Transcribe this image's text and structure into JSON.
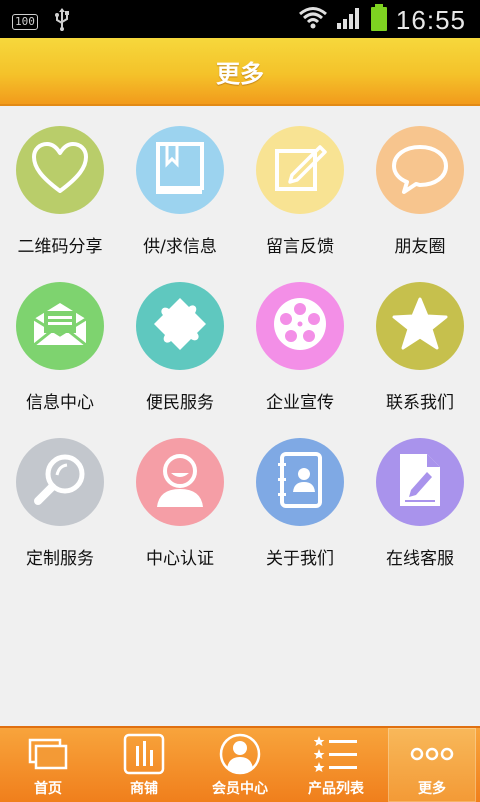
{
  "status_bar": {
    "battery_text": "100",
    "time": "16:55"
  },
  "header": {
    "title": "更多"
  },
  "grid": {
    "items": [
      {
        "label": "二维码分享",
        "icon": "heart-icon",
        "color": "#b9cd6a"
      },
      {
        "label": "供/求信息",
        "icon": "book-icon",
        "color": "#9cd3ef"
      },
      {
        "label": "留言反馈",
        "icon": "edit-icon",
        "color": "#f8e393"
      },
      {
        "label": "朋友圈",
        "icon": "chat-bubble-icon",
        "color": "#f7c58e"
      },
      {
        "label": "信息中心",
        "icon": "mail-icon",
        "color": "#7ed36f"
      },
      {
        "label": "便民服务",
        "icon": "puzzle-icon",
        "color": "#5fc8bf"
      },
      {
        "label": "企业宣传",
        "icon": "film-reel-icon",
        "color": "#f38fe7"
      },
      {
        "label": "联系我们",
        "icon": "star-icon",
        "color": "#c6c04d"
      },
      {
        "label": "定制服务",
        "icon": "magnifier-icon",
        "color": "#c3c7cd"
      },
      {
        "label": "中心认证",
        "icon": "user-icon",
        "color": "#f59ea6"
      },
      {
        "label": "关于我们",
        "icon": "contacts-icon",
        "color": "#7fa9e4"
      },
      {
        "label": "在线客服",
        "icon": "document-edit-icon",
        "color": "#a993ec"
      }
    ]
  },
  "tabbar": {
    "tabs": [
      {
        "label": "首页",
        "icon": "windows-icon",
        "active": false
      },
      {
        "label": "商铺",
        "icon": "shop-bars-icon",
        "active": false
      },
      {
        "label": "会员中心",
        "icon": "member-icon",
        "active": false
      },
      {
        "label": "产品列表",
        "icon": "list-stars-icon",
        "active": false
      },
      {
        "label": "更多",
        "icon": "more-dots-icon",
        "active": true
      }
    ]
  }
}
